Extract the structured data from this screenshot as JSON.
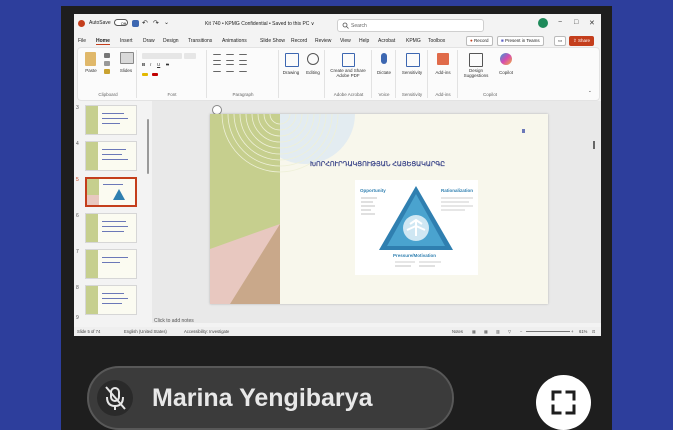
{
  "titlebar": {
    "autosave": "AutoSave",
    "toggle": "Off",
    "doc_title": "Kit 740 • KPMG Confidential • Saved to this PC ∨",
    "search_placeholder": "Search",
    "minimize": "−",
    "restore": "□",
    "close": "✕"
  },
  "tabs": [
    "File",
    "Home",
    "Insert",
    "Draw",
    "Design",
    "Transitions",
    "Animations",
    "Slide Show",
    "Record",
    "Review",
    "View",
    "Help",
    "Acrobat",
    "KPMG",
    "Toolbox"
  ],
  "ribbon_buttons": {
    "record": "Record",
    "present": "Present in Teams",
    "share": "Share"
  },
  "ribbon": {
    "paste": "Paste",
    "slides": "Slides",
    "drawing": "Drawing",
    "editing": "Editing",
    "create_share": "Create and Share Adobe PDF",
    "dictate": "Dictate",
    "sensitivity": "Sensitivity",
    "addins": "Add-ins",
    "designer": "Design Suggestions",
    "copilot": "Copilot",
    "groups": [
      "Clipboard",
      "Font",
      "Paragraph",
      "Adobe Acrobat",
      "Voice",
      "Sensitivity",
      "Add-ins",
      "Copilot"
    ]
  },
  "thumbnails": [
    {
      "num": "3",
      "selected": false
    },
    {
      "num": "4",
      "selected": false
    },
    {
      "num": "5",
      "selected": true
    },
    {
      "num": "6",
      "selected": false
    },
    {
      "num": "7",
      "selected": false
    },
    {
      "num": "8",
      "selected": false
    },
    {
      "num": "9",
      "selected": false
    }
  ],
  "slide": {
    "title": "ԽՈՐՀՈՒՐԴԱԿՑՈՒԹՅԱՆ ՀԱՅԵՑԱԿԱՐԳԸ",
    "opportunity": "Opportunity",
    "rationalization": "Rationalization",
    "pressure": "Pressure/Motivation",
    "accent_colors": [
      "#c6cf8e",
      "#e8c8c0",
      "#c9a88a",
      "#2f7fb0",
      "#6b78b8"
    ]
  },
  "notes_placeholder": "Click to add notes",
  "status": {
    "slide_of": "Slide 5 of 74",
    "language": "English (United States)",
    "accessibility": "Accessibility: Investigate",
    "notes": "Notes",
    "zoom": "61%"
  },
  "participant": {
    "name": "Marina Yengibarya",
    "mic": "mic-off-icon"
  },
  "controls": {
    "fullscreen": "fullscreen-icon"
  }
}
